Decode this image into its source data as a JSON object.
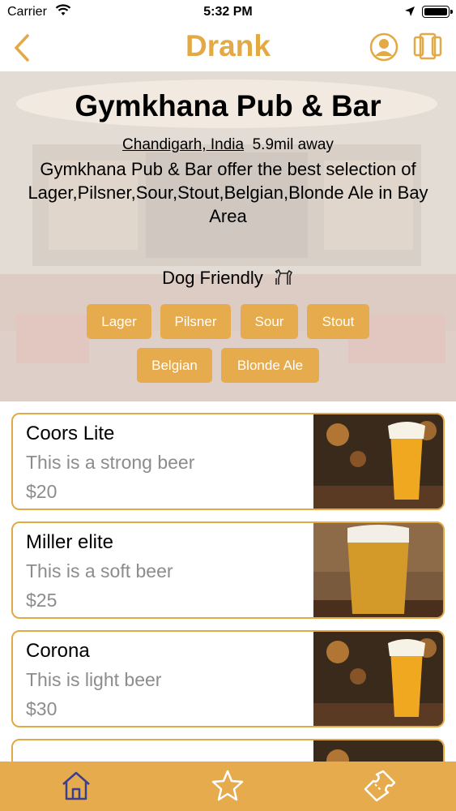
{
  "status_bar": {
    "carrier": "Carrier",
    "time": "5:32 PM"
  },
  "nav": {
    "title": "Drank",
    "back_icon": "chevron-left-icon",
    "profile_icon": "user-circle-icon",
    "menu_icon": "cards-icon"
  },
  "pub": {
    "name": "Gymkhana Pub & Bar",
    "location": "Chandigarh, India",
    "distance": "5.9mil away",
    "description": "Gymkhana Pub & Bar offer the best selection of Lager,Pilsner,Sour,Stout,Belgian,Blonde Ale in Bay Area",
    "feature": "Dog Friendly",
    "tags": [
      "Lager",
      "Pilsner",
      "Sour",
      "Stout",
      "Belgian",
      "Blonde Ale"
    ]
  },
  "beers": [
    {
      "name": "Coors Lite",
      "description": "This is a strong beer",
      "price": "$20"
    },
    {
      "name": "Miller elite",
      "description": "This is a soft beer",
      "price": "$25"
    },
    {
      "name": "Corona",
      "description": "This is light beer",
      "price": "$30"
    }
  ],
  "tab_bar": {
    "items": [
      "home-icon",
      "star-icon",
      "ticket-icon"
    ]
  },
  "colors": {
    "accent": "#e2a945",
    "tag_bg": "#e5ab4c",
    "muted_text": "#8c8c8c"
  }
}
